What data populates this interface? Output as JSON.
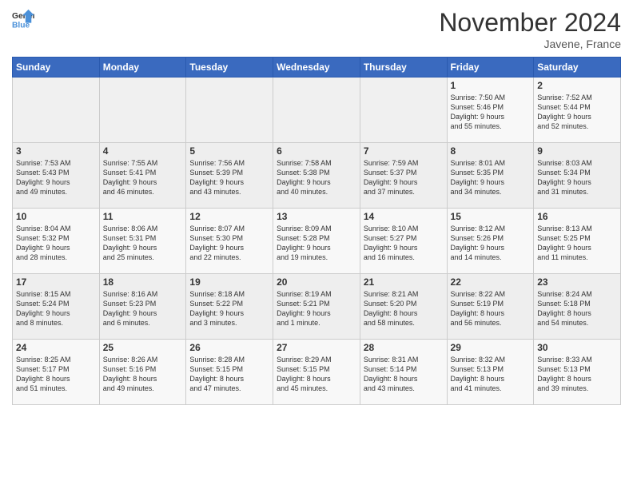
{
  "header": {
    "logo": {
      "line1": "General",
      "line2": "Blue"
    },
    "title": "November 2024",
    "location": "Javene, France"
  },
  "weekdays": [
    "Sunday",
    "Monday",
    "Tuesday",
    "Wednesday",
    "Thursday",
    "Friday",
    "Saturday"
  ],
  "weeks": [
    [
      {
        "day": "",
        "info": ""
      },
      {
        "day": "",
        "info": ""
      },
      {
        "day": "",
        "info": ""
      },
      {
        "day": "",
        "info": ""
      },
      {
        "day": "",
        "info": ""
      },
      {
        "day": "1",
        "info": "Sunrise: 7:50 AM\nSunset: 5:46 PM\nDaylight: 9 hours\nand 55 minutes."
      },
      {
        "day": "2",
        "info": "Sunrise: 7:52 AM\nSunset: 5:44 PM\nDaylight: 9 hours\nand 52 minutes."
      }
    ],
    [
      {
        "day": "3",
        "info": "Sunrise: 7:53 AM\nSunset: 5:43 PM\nDaylight: 9 hours\nand 49 minutes."
      },
      {
        "day": "4",
        "info": "Sunrise: 7:55 AM\nSunset: 5:41 PM\nDaylight: 9 hours\nand 46 minutes."
      },
      {
        "day": "5",
        "info": "Sunrise: 7:56 AM\nSunset: 5:39 PM\nDaylight: 9 hours\nand 43 minutes."
      },
      {
        "day": "6",
        "info": "Sunrise: 7:58 AM\nSunset: 5:38 PM\nDaylight: 9 hours\nand 40 minutes."
      },
      {
        "day": "7",
        "info": "Sunrise: 7:59 AM\nSunset: 5:37 PM\nDaylight: 9 hours\nand 37 minutes."
      },
      {
        "day": "8",
        "info": "Sunrise: 8:01 AM\nSunset: 5:35 PM\nDaylight: 9 hours\nand 34 minutes."
      },
      {
        "day": "9",
        "info": "Sunrise: 8:03 AM\nSunset: 5:34 PM\nDaylight: 9 hours\nand 31 minutes."
      }
    ],
    [
      {
        "day": "10",
        "info": "Sunrise: 8:04 AM\nSunset: 5:32 PM\nDaylight: 9 hours\nand 28 minutes."
      },
      {
        "day": "11",
        "info": "Sunrise: 8:06 AM\nSunset: 5:31 PM\nDaylight: 9 hours\nand 25 minutes."
      },
      {
        "day": "12",
        "info": "Sunrise: 8:07 AM\nSunset: 5:30 PM\nDaylight: 9 hours\nand 22 minutes."
      },
      {
        "day": "13",
        "info": "Sunrise: 8:09 AM\nSunset: 5:28 PM\nDaylight: 9 hours\nand 19 minutes."
      },
      {
        "day": "14",
        "info": "Sunrise: 8:10 AM\nSunset: 5:27 PM\nDaylight: 9 hours\nand 16 minutes."
      },
      {
        "day": "15",
        "info": "Sunrise: 8:12 AM\nSunset: 5:26 PM\nDaylight: 9 hours\nand 14 minutes."
      },
      {
        "day": "16",
        "info": "Sunrise: 8:13 AM\nSunset: 5:25 PM\nDaylight: 9 hours\nand 11 minutes."
      }
    ],
    [
      {
        "day": "17",
        "info": "Sunrise: 8:15 AM\nSunset: 5:24 PM\nDaylight: 9 hours\nand 8 minutes."
      },
      {
        "day": "18",
        "info": "Sunrise: 8:16 AM\nSunset: 5:23 PM\nDaylight: 9 hours\nand 6 minutes."
      },
      {
        "day": "19",
        "info": "Sunrise: 8:18 AM\nSunset: 5:22 PM\nDaylight: 9 hours\nand 3 minutes."
      },
      {
        "day": "20",
        "info": "Sunrise: 8:19 AM\nSunset: 5:21 PM\nDaylight: 9 hours\nand 1 minute."
      },
      {
        "day": "21",
        "info": "Sunrise: 8:21 AM\nSunset: 5:20 PM\nDaylight: 8 hours\nand 58 minutes."
      },
      {
        "day": "22",
        "info": "Sunrise: 8:22 AM\nSunset: 5:19 PM\nDaylight: 8 hours\nand 56 minutes."
      },
      {
        "day": "23",
        "info": "Sunrise: 8:24 AM\nSunset: 5:18 PM\nDaylight: 8 hours\nand 54 minutes."
      }
    ],
    [
      {
        "day": "24",
        "info": "Sunrise: 8:25 AM\nSunset: 5:17 PM\nDaylight: 8 hours\nand 51 minutes."
      },
      {
        "day": "25",
        "info": "Sunrise: 8:26 AM\nSunset: 5:16 PM\nDaylight: 8 hours\nand 49 minutes."
      },
      {
        "day": "26",
        "info": "Sunrise: 8:28 AM\nSunset: 5:15 PM\nDaylight: 8 hours\nand 47 minutes."
      },
      {
        "day": "27",
        "info": "Sunrise: 8:29 AM\nSunset: 5:15 PM\nDaylight: 8 hours\nand 45 minutes."
      },
      {
        "day": "28",
        "info": "Sunrise: 8:31 AM\nSunset: 5:14 PM\nDaylight: 8 hours\nand 43 minutes."
      },
      {
        "day": "29",
        "info": "Sunrise: 8:32 AM\nSunset: 5:13 PM\nDaylight: 8 hours\nand 41 minutes."
      },
      {
        "day": "30",
        "info": "Sunrise: 8:33 AM\nSunset: 5:13 PM\nDaylight: 8 hours\nand 39 minutes."
      }
    ]
  ]
}
